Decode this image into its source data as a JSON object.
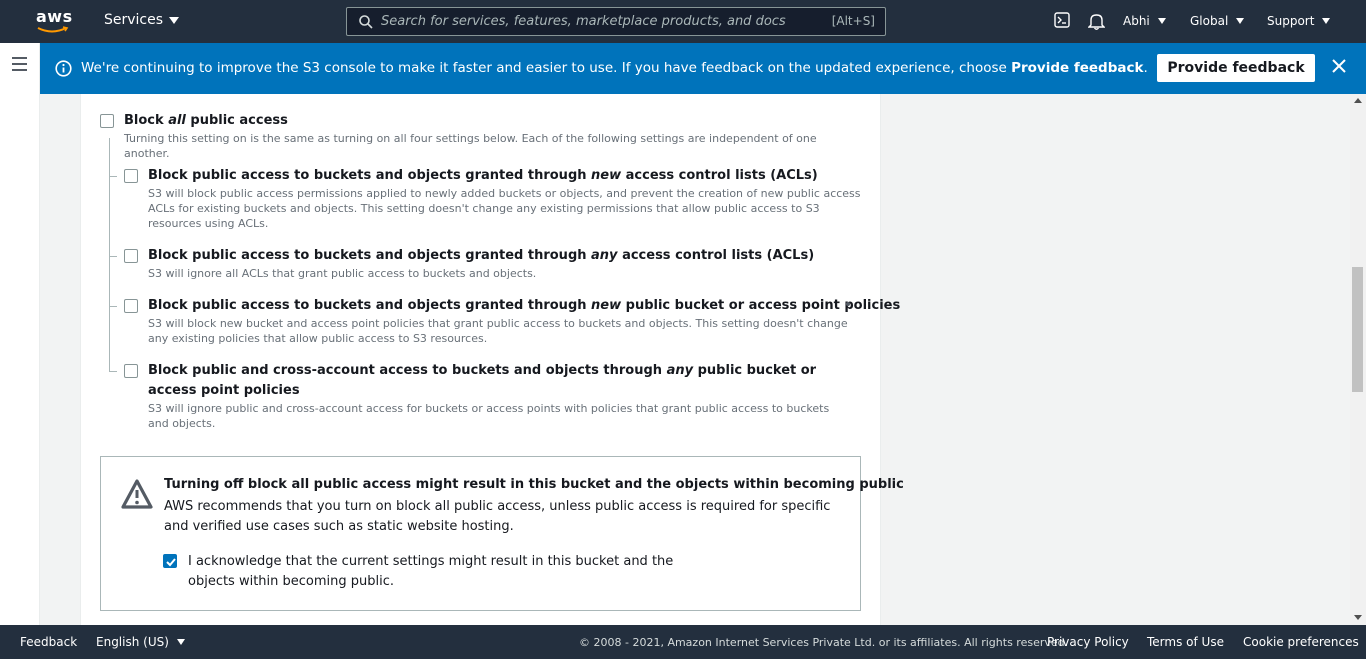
{
  "topnav": {
    "logo_text": "aws",
    "services_label": "Services",
    "search_placeholder": "Search for services, features, marketplace products, and docs",
    "search_shortcut": "[Alt+S]",
    "user_label": "Abhi",
    "region_label": "Global",
    "support_label": "Support",
    "icons": [
      "cloudshell-icon",
      "bell-icon"
    ]
  },
  "banner": {
    "message_prefix": "We're continuing to improve the S3 console to make it faster and easier to use. If you have feedback on the updated experience, choose ",
    "message_bold": "Provide feedback",
    "message_suffix": ".",
    "button_label": "Provide feedback",
    "color": "#0073bb"
  },
  "block_all": {
    "title_pre": "Block ",
    "title_em": "all",
    "title_post": " public access",
    "description": "Turning this setting on is the same as turning on all four settings below. Each of the following settings are independent of one another.",
    "checked": false
  },
  "options": [
    {
      "title_pre": "Block public access to buckets and objects granted through ",
      "title_em": "new",
      "title_post": " access control lists (ACLs)",
      "description": "S3 will block public access permissions applied to newly added buckets or objects, and prevent the creation of new public access ACLs for existing buckets and objects. This setting doesn't change any existing permissions that allow public access to S3 resources using ACLs.",
      "checked": false
    },
    {
      "title_pre": "Block public access to buckets and objects granted through ",
      "title_em": "any",
      "title_post": " access control lists (ACLs)",
      "description": "S3 will ignore all ACLs that grant public access to buckets and objects.",
      "checked": false
    },
    {
      "title_pre": "Block public access to buckets and objects granted through ",
      "title_em": "new",
      "title_post": " public bucket or access point policies",
      "description": "S3 will block new bucket and access point policies that grant public access to buckets and objects. This setting doesn't change any existing policies that allow public access to S3 resources.",
      "checked": false
    },
    {
      "title_pre": "Block public and cross-account access to buckets and objects through ",
      "title_em": "any",
      "title_post": " public bucket or access point policies",
      "description": "S3 will ignore public and cross-account access for buckets or access points with policies that grant public access to buckets and objects.",
      "checked": false
    }
  ],
  "warning": {
    "title": "Turning off block all public access might result in this bucket and the objects within becoming public",
    "description": "AWS recommends that you turn on block all public access, unless public access is required for specific and verified use cases such as static website hosting.",
    "acknowledge_label": "I acknowledge that the current settings might result in this bucket and the objects within becoming public.",
    "acknowledge_checked": true
  },
  "footer": {
    "feedback": "Feedback",
    "language": "English (US)",
    "copyright": "© 2008 - 2021, Amazon Internet Services Private Ltd. or its affiliates. All rights reserved.",
    "privacy": "Privacy Policy",
    "terms": "Terms of Use",
    "cookies": "Cookie preferences"
  }
}
